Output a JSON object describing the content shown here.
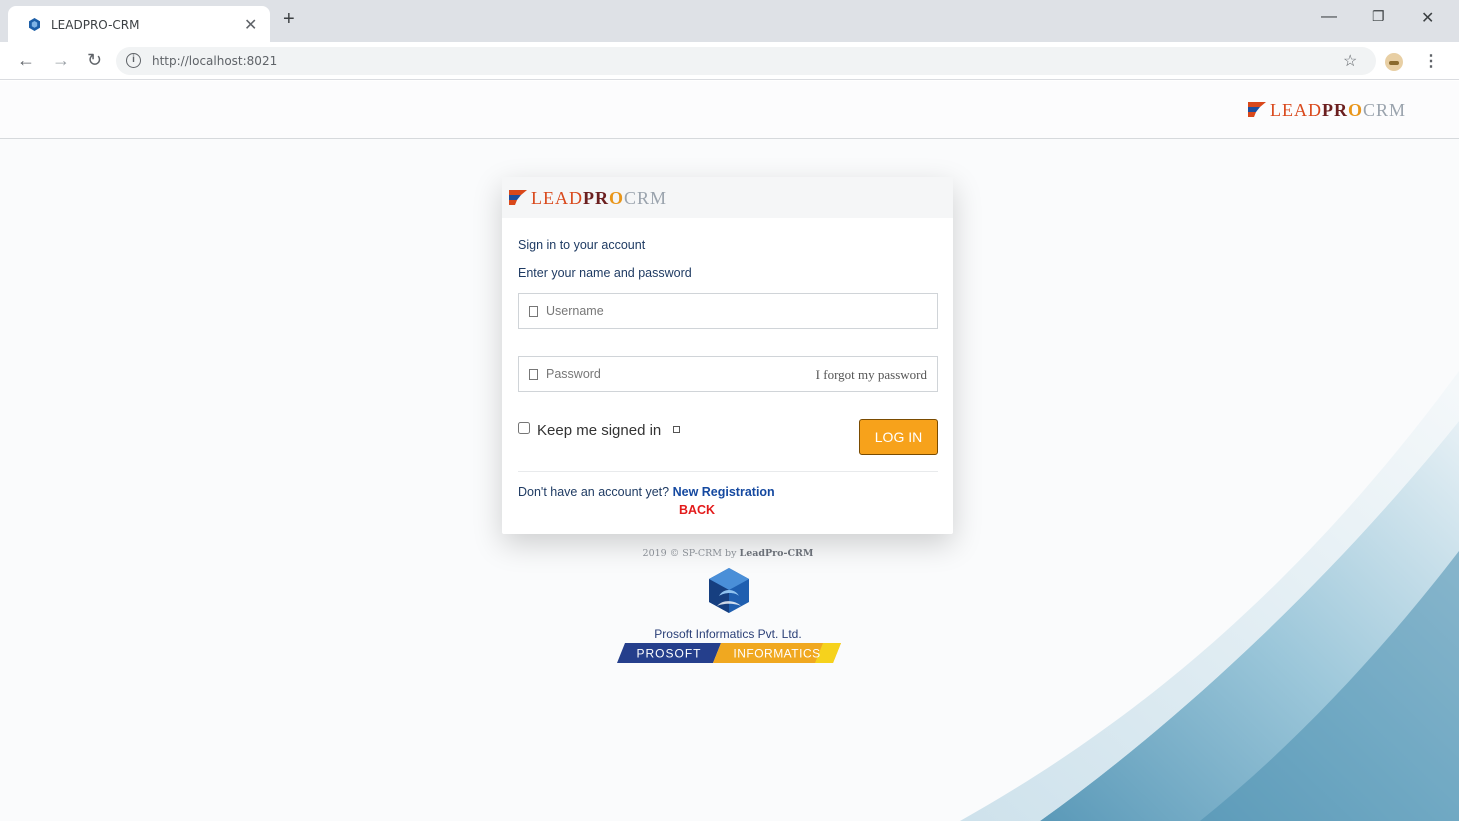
{
  "browser": {
    "tab_title": "LEADPRO-CRM",
    "new_tab_label": "+",
    "url": "http://localhost:8021"
  },
  "icons": {
    "favicon": "hexagon-favicon-icon",
    "back": "back-arrow-icon",
    "forward": "forward-arrow-icon",
    "reload": "reload-icon",
    "info": "info-icon",
    "star": "star-icon",
    "menu": "kebab-menu-icon",
    "minimize": "minimize-icon",
    "restore": "restore-icon",
    "close": "close-icon"
  },
  "logo": {
    "lead": "LEAD",
    "pro": "PR",
    "o": "O",
    "crm": "CRM"
  },
  "login": {
    "heading": "Sign in to your account",
    "subheading": "Enter your name and password",
    "username_placeholder": "Username",
    "password_placeholder": "Password",
    "forgot_link": "I forgot my password",
    "keep_signed_in": "Keep me signed in",
    "login_button": "LOG IN",
    "no_account_text": "Don't have an account yet?",
    "registration_link": "New Registration",
    "back_link": "BACK"
  },
  "footer": {
    "copyright_prefix": "2019 © SP-CRM by",
    "copyright_brand": "LeadPro-CRM",
    "company_name": "Prosoft Informatics Pvt. Ltd.",
    "banner_left": "PROSOFT",
    "banner_right": "INFORMATICS"
  },
  "colors": {
    "accent_button": "#f7a21b",
    "link_blue": "#1549a0",
    "back_red": "#e31b1b",
    "text_navy": "#1f3b63"
  }
}
